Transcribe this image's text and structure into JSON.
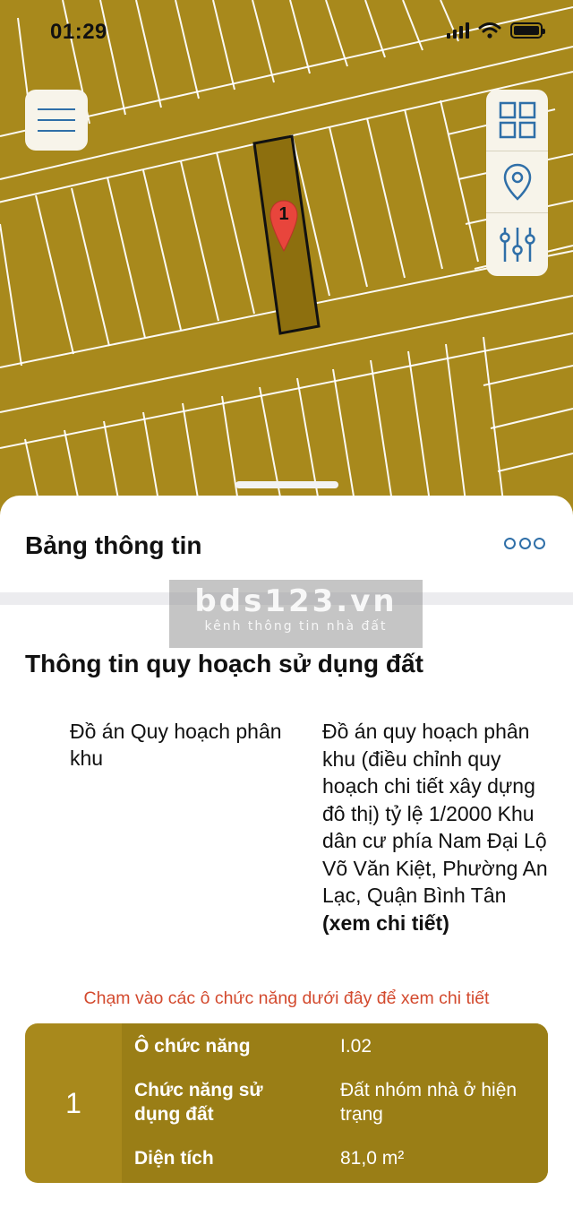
{
  "status_bar": {
    "time": "01:29"
  },
  "map": {
    "marker_label": "1",
    "colors": {
      "parcel": "#a8891c",
      "highlight": "#8d6f0e",
      "lines": "#ffffff"
    }
  },
  "sheet": {
    "title": "Bảng thông tin",
    "watermark": {
      "main": "bds123.vn",
      "sub": "kênh thông tin nhà đất"
    },
    "section_title": "Thông tin quy hoạch sử dụng đất",
    "plan": {
      "label": "Đồ án Quy hoạch phân khu",
      "value": "Đồ án quy hoạch phân khu (điều chỉnh quy hoạch chi tiết xây dựng đô thị) tỷ lệ 1/2000 Khu dân cư phía Nam Đại Lộ Võ Văn Kiệt, Phường An Lạc, Quận Bình Tân",
      "link": "(xem chi tiết)"
    },
    "hint": "Chạm vào các ô chức năng dưới đây để xem chi tiết",
    "card": {
      "number": "1",
      "rows": [
        {
          "label": "Ô chức năng",
          "value": "I.02"
        },
        {
          "label": "Chức năng sử dụng đất",
          "value": "Đất nhóm nhà ở hiện trạng"
        },
        {
          "label": "Diện tích",
          "value": "81,0 m²"
        }
      ]
    }
  }
}
